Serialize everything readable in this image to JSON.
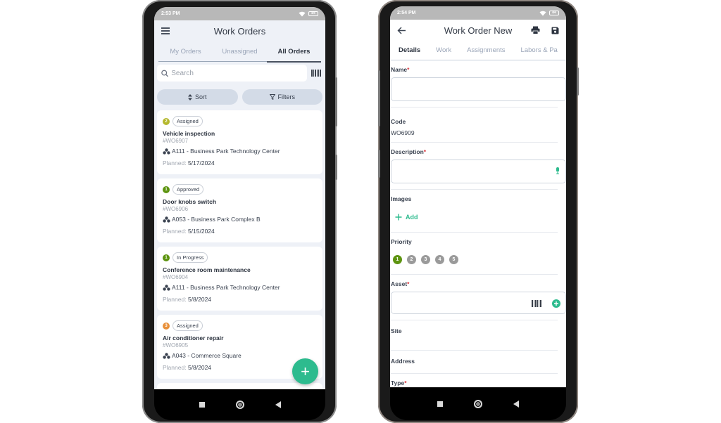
{
  "left_phone": {
    "status_bar": {
      "time": "2:53 PM",
      "battery": "84"
    },
    "header": {
      "title": "Work Orders",
      "menu_icon": "hamburger-icon"
    },
    "tabs": [
      {
        "label": "My Orders",
        "active": false
      },
      {
        "label": "Unassigned",
        "active": false
      },
      {
        "label": "All Orders",
        "active": true
      }
    ],
    "search": {
      "placeholder": "Search",
      "value": "",
      "scan_icon": "barcode-icon"
    },
    "actions": {
      "sort_label": "Sort",
      "filters_label": "Filters"
    },
    "work_orders": [
      {
        "priority": "2",
        "priority_color": "#b5b82e",
        "status": "Assigned",
        "title": "Vehicle inspection",
        "code": "WO6907",
        "asset": "A111 - Business Park Technology Center",
        "planned_label": "Planned:",
        "planned_date": "5/17/2024"
      },
      {
        "priority": "1",
        "priority_color": "#5d9410",
        "status": "Approved",
        "title": "Door knobs switch",
        "code": "WO6906",
        "asset": "A053 - Business Park Complex B",
        "planned_label": "Planned:",
        "planned_date": "5/15/2024"
      },
      {
        "priority": "1",
        "priority_color": "#5d9410",
        "status": "In Progress",
        "title": "Conference room maintenance",
        "code": "WO6904",
        "asset": "A111 - Business Park Technology Center",
        "planned_label": "Planned:",
        "planned_date": "5/8/2024"
      },
      {
        "priority": "3",
        "priority_color": "#e8903a",
        "status": "Assigned",
        "title": "Air conditioner repair",
        "code": "WO6905",
        "asset": "A043 - Commerce Square",
        "planned_label": "Planned:",
        "planned_date": "5/8/2024"
      }
    ],
    "fab_label": "+",
    "accent_color": "#2dbb8e"
  },
  "right_phone": {
    "status_bar": {
      "time": "2:54 PM",
      "battery": "84"
    },
    "header": {
      "title": "Work Order New",
      "back_icon": "arrow-left-icon",
      "print_icon": "printer-icon",
      "save_icon": "save-icon"
    },
    "tabs": [
      {
        "label": "Details",
        "active": true
      },
      {
        "label": "Work",
        "active": false
      },
      {
        "label": "Assignments",
        "active": false
      },
      {
        "label": "Labors & Pa",
        "active": false
      }
    ],
    "form": {
      "name": {
        "label": "Name",
        "required": true,
        "value": ""
      },
      "code": {
        "label": "Code",
        "value": "WO6909"
      },
      "description": {
        "label": "Description",
        "required": true,
        "value": ""
      },
      "images": {
        "label": "Images",
        "add_label": "Add"
      },
      "priority": {
        "label": "Priority",
        "options": [
          "1",
          "2",
          "3",
          "4",
          "5"
        ],
        "selected": "1"
      },
      "asset": {
        "label": "Asset",
        "required": true,
        "value": ""
      },
      "site": {
        "label": "Site",
        "value": ""
      },
      "address": {
        "label": "Address",
        "value": ""
      },
      "type": {
        "label": "Type",
        "required": true
      }
    },
    "required_marker": "*"
  }
}
